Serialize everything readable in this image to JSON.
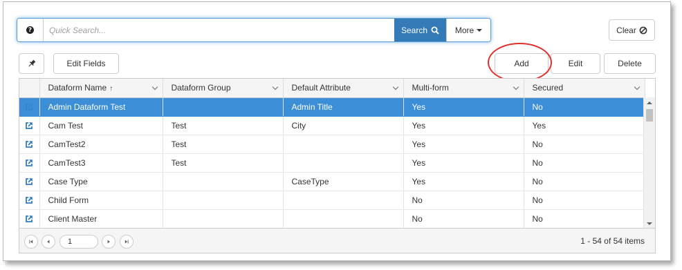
{
  "search": {
    "placeholder": "Quick Search...",
    "value": "",
    "search_label": "Search",
    "more_label": "More"
  },
  "toolbar": {
    "clear_label": "Clear",
    "edit_fields_label": "Edit Fields",
    "add_label": "Add",
    "edit_label": "Edit",
    "delete_label": "Delete"
  },
  "grid": {
    "columns": [
      {
        "label": "Dataform Name",
        "sort": "↑"
      },
      {
        "label": "Dataform Group"
      },
      {
        "label": "Default Attribute"
      },
      {
        "label": "Multi-form"
      },
      {
        "label": "Secured"
      }
    ],
    "rows": [
      {
        "name": "Admin Dataform Test",
        "group": "",
        "attribute": "Admin Title",
        "multi": "Yes",
        "secured": "No",
        "selected": true
      },
      {
        "name": "Cam Test",
        "group": "Test",
        "attribute": "City",
        "multi": "Yes",
        "secured": "Yes"
      },
      {
        "name": "CamTest2",
        "group": "Test",
        "attribute": "",
        "multi": "Yes",
        "secured": "No"
      },
      {
        "name": "CamTest3",
        "group": "Test",
        "attribute": "",
        "multi": "Yes",
        "secured": "No"
      },
      {
        "name": "Case Type",
        "group": "",
        "attribute": "CaseType",
        "multi": "Yes",
        "secured": "No"
      },
      {
        "name": "Child Form",
        "group": "",
        "attribute": "",
        "multi": "No",
        "secured": "No"
      },
      {
        "name": "Client Master",
        "group": "",
        "attribute": "",
        "multi": "No",
        "secured": "No"
      }
    ]
  },
  "pager": {
    "page": "1",
    "info": "1 - 54 of 54 items"
  },
  "colors": {
    "accent": "#337ab7",
    "selected_row": "#3c8fd6",
    "highlight": "#e0302c"
  }
}
